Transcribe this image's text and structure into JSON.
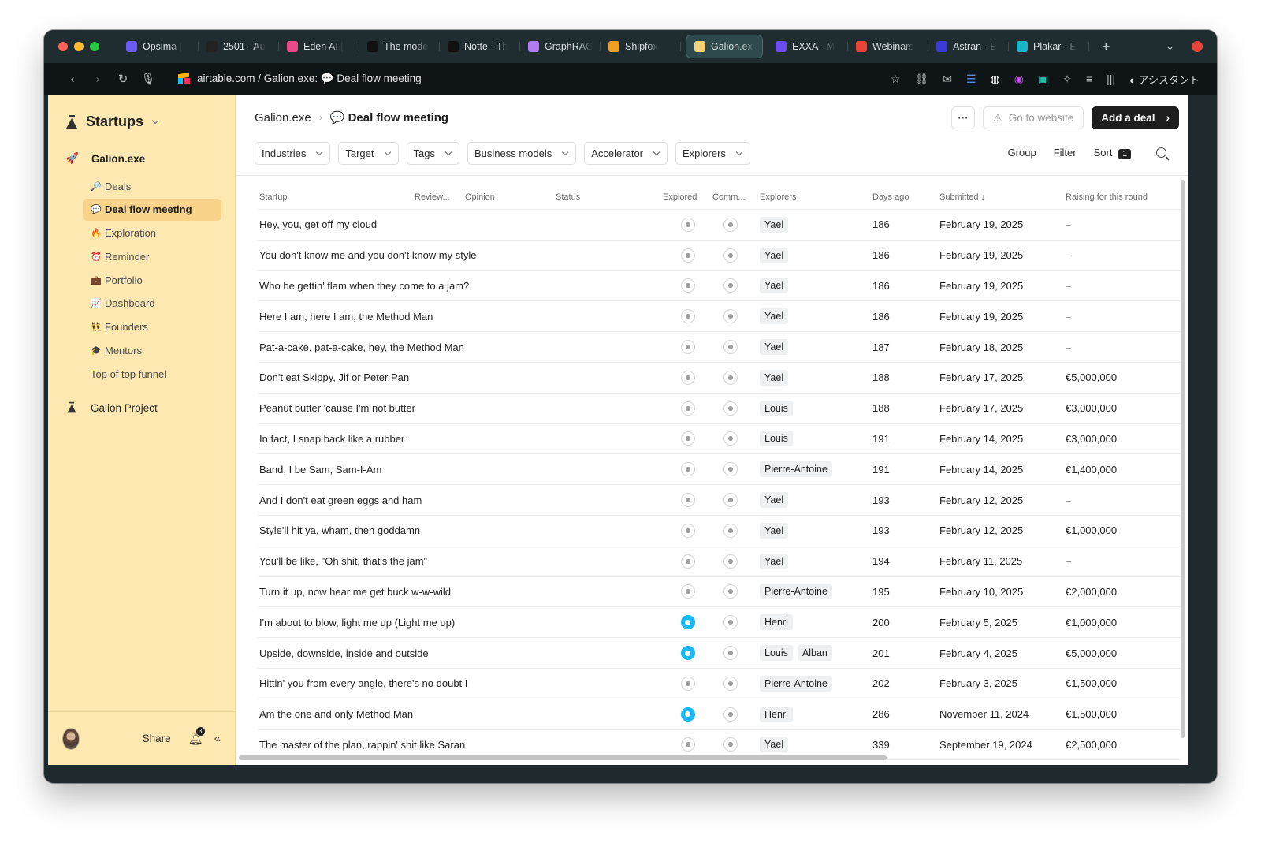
{
  "browser": {
    "tabs": [
      {
        "label": "Opsima |",
        "color": "#6b5cf6"
      },
      {
        "label": "2501 - Au",
        "color": "#222222"
      },
      {
        "label": "Eden AI |",
        "color": "#e84a8a"
      },
      {
        "label": "The mode",
        "color": "#111111"
      },
      {
        "label": "Notte - Th",
        "color": "#111111"
      },
      {
        "label": "GraphRAG",
        "color": "#b07cf0"
      },
      {
        "label": "Shipfox",
        "color": "#f0a020"
      },
      {
        "label": "Galion.exe",
        "color": "#f3d27a"
      },
      {
        "label": "EXXA - M",
        "color": "#6a4cf0"
      },
      {
        "label": "Webinars",
        "color": "#e8443a"
      },
      {
        "label": "Astran - E",
        "color": "#3d3bd8"
      },
      {
        "label": "Plakar - E",
        "color": "#17b7c9"
      }
    ],
    "url_text": "airtable.com / Galion.exe: 💬 Deal flow meeting",
    "assistant_label": "アシスタント"
  },
  "sidebar": {
    "title": "Startups",
    "workspace": "Galion.exe",
    "items": [
      {
        "emoji": "🔎",
        "label": "Deals",
        "active": false
      },
      {
        "emoji": "💬",
        "label": "Deal flow meeting",
        "active": true
      },
      {
        "emoji": "🔥",
        "label": "Exploration",
        "active": false
      },
      {
        "emoji": "⏰",
        "label": "Reminder",
        "active": false
      },
      {
        "emoji": "💼",
        "label": "Portfolio",
        "active": false
      },
      {
        "emoji": "📈",
        "label": "Dashboard",
        "active": false
      },
      {
        "emoji": "👯",
        "label": "Founders",
        "active": false
      },
      {
        "emoji": "🎓",
        "label": "Mentors",
        "active": false
      },
      {
        "emoji": "",
        "label": "Top of top funnel",
        "active": false
      }
    ],
    "project": "Galion Project",
    "share_label": "Share",
    "notifications": "3"
  },
  "header": {
    "breadcrumb_root": "Galion.exe",
    "breadcrumb_current": "💬 Deal flow meeting",
    "more_label": "···",
    "website_label": "Go to website",
    "add_label": "Add a deal"
  },
  "filters": [
    "Industries",
    "Target",
    "Tags",
    "Business models",
    "Accelerator",
    "Explorers"
  ],
  "tools": {
    "group": "Group",
    "filter": "Filter",
    "sort": "Sort",
    "sort_count": "1"
  },
  "table": {
    "columns": {
      "startup": "Startup",
      "review": "Review...",
      "opinion": "Opinion",
      "status": "Status",
      "explored": "Explored",
      "comm": "Comm...",
      "explorers": "Explorers",
      "days": "Days ago",
      "submitted": "Submitted",
      "raising": "Raising for this round"
    },
    "rows": [
      {
        "startup": "Hey, you, get off my cloud",
        "explored": false,
        "explorers": [
          "Yael"
        ],
        "days": "186",
        "submitted": "February 19, 2025",
        "raising": "–"
      },
      {
        "startup": "You don't know me and you don't know my style",
        "explored": false,
        "explorers": [
          "Yael"
        ],
        "days": "186",
        "submitted": "February 19, 2025",
        "raising": "–"
      },
      {
        "startup": "Who be gettin' flam when they come to a jam?",
        "explored": false,
        "explorers": [
          "Yael"
        ],
        "days": "186",
        "submitted": "February 19, 2025",
        "raising": "–"
      },
      {
        "startup": "Here I am, here I am, the Method Man",
        "explored": false,
        "explorers": [
          "Yael"
        ],
        "days": "186",
        "submitted": "February 19, 2025",
        "raising": "–"
      },
      {
        "startup": "Pat-a-cake, pat-a-cake, hey, the Method Man",
        "explored": false,
        "explorers": [
          "Yael"
        ],
        "days": "187",
        "submitted": "February 18, 2025",
        "raising": "–"
      },
      {
        "startup": "Don't eat Skippy, Jif or Peter Pan",
        "explored": false,
        "explorers": [
          "Yael"
        ],
        "days": "188",
        "submitted": "February 17, 2025",
        "raising": "€5,000,000"
      },
      {
        "startup": "Peanut butter 'cause I'm not butter",
        "explored": false,
        "explorers": [
          "Louis"
        ],
        "days": "188",
        "submitted": "February 17, 2025",
        "raising": "€3,000,000"
      },
      {
        "startup": "In fact, I snap back like a rubber",
        "explored": false,
        "explorers": [
          "Louis"
        ],
        "days": "191",
        "submitted": "February 14, 2025",
        "raising": "€3,000,000"
      },
      {
        "startup": "Band, I be Sam, Sam-I-Am",
        "explored": false,
        "explorers": [
          "Pierre-Antoine"
        ],
        "days": "191",
        "submitted": "February 14, 2025",
        "raising": "€1,400,000"
      },
      {
        "startup": "And I don't eat green eggs and ham",
        "explored": false,
        "explorers": [
          "Yael"
        ],
        "days": "193",
        "submitted": "February 12, 2025",
        "raising": "–"
      },
      {
        "startup": "Style'll hit ya, wham, then goddamn",
        "explored": false,
        "explorers": [
          "Yael"
        ],
        "days": "193",
        "submitted": "February 12, 2025",
        "raising": "€1,000,000"
      },
      {
        "startup": "You'll be like, \"Oh shit, that's the jam\"",
        "explored": false,
        "explorers": [
          "Yael"
        ],
        "days": "194",
        "submitted": "February 11, 2025",
        "raising": "–"
      },
      {
        "startup": "Turn it up, now hear me get buck w-w-wild",
        "explored": false,
        "explorers": [
          "Pierre-Antoine"
        ],
        "days": "195",
        "submitted": "February 10, 2025",
        "raising": "€2,000,000"
      },
      {
        "startup": "I'm about to blow, light me up (Light me up)",
        "explored": true,
        "explorers": [
          "Henri"
        ],
        "days": "200",
        "submitted": "February 5, 2025",
        "raising": "€1,000,000"
      },
      {
        "startup": "Upside, downside, inside and outside",
        "explored": true,
        "explorers": [
          "Louis",
          "Alban"
        ],
        "days": "201",
        "submitted": "February 4, 2025",
        "raising": "€5,000,000"
      },
      {
        "startup": "Hittin' you from every angle, there's no doubt I",
        "explored": false,
        "explorers": [
          "Pierre-Antoine"
        ],
        "days": "202",
        "submitted": "February 3, 2025",
        "raising": "€1,500,000"
      },
      {
        "startup": "Am the one and only Method Man",
        "explored": true,
        "explorers": [
          "Henri"
        ],
        "days": "286",
        "submitted": "November 11, 2024",
        "raising": "€1,500,000"
      },
      {
        "startup": "The master of the plan, rappin' shit like Saran",
        "explored": false,
        "explorers": [
          "Yael"
        ],
        "days": "339",
        "submitted": "September 19, 2024",
        "raising": "€2,500,000"
      }
    ]
  }
}
